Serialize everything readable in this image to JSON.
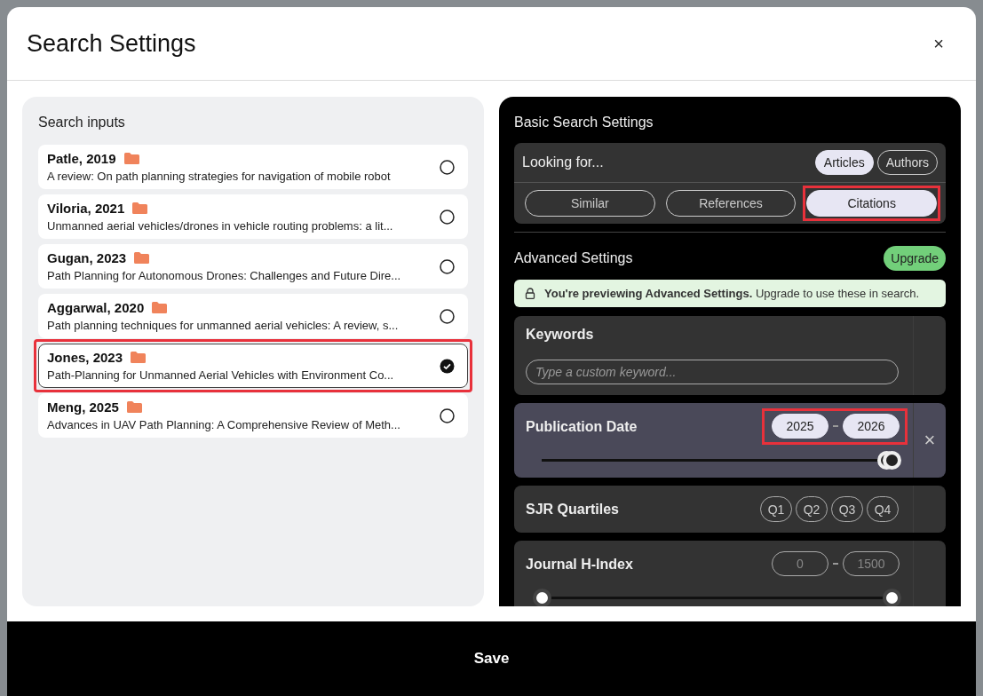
{
  "dialog": {
    "title": "Search Settings",
    "close": "×"
  },
  "search_inputs": {
    "heading": "Search inputs",
    "items": [
      {
        "author": "Patle, 2019",
        "title": "A review: On path planning strategies for navigation of mobile robot",
        "selected": false,
        "highlighted": false
      },
      {
        "author": "Viloria, 2021",
        "title": "Unmanned aerial vehicles/drones in vehicle routing problems: a lit...",
        "selected": false,
        "highlighted": false
      },
      {
        "author": "Gugan, 2023",
        "title": "Path Planning for Autonomous Drones: Challenges and Future Dire...",
        "selected": false,
        "highlighted": false
      },
      {
        "author": "Aggarwal, 2020",
        "title": "Path planning techniques for unmanned aerial vehicles: A review, s...",
        "selected": false,
        "highlighted": false
      },
      {
        "author": "Jones, 2023",
        "title": "Path-Planning for Unmanned Aerial Vehicles with Environment Co...",
        "selected": true,
        "highlighted": true
      },
      {
        "author": "Meng, 2025",
        "title": "Advances in UAV Path Planning: A Comprehensive Review of Meth...",
        "selected": false,
        "highlighted": false
      }
    ]
  },
  "basic": {
    "heading": "Basic Search Settings",
    "looking_for": "Looking for...",
    "targets": [
      {
        "label": "Articles",
        "selected": true
      },
      {
        "label": "Authors",
        "selected": false
      }
    ],
    "modes": [
      {
        "label": "Similar",
        "selected": false,
        "highlighted": false
      },
      {
        "label": "References",
        "selected": false,
        "highlighted": false
      },
      {
        "label": "Citations",
        "selected": true,
        "highlighted": true
      }
    ]
  },
  "advanced": {
    "heading": "Advanced Settings",
    "upgrade": "Upgrade",
    "notice": "**You're previewing Advanced Settings.** Upgrade to use these in search.",
    "filters": [
      {
        "kind": "text",
        "label": "Keywords",
        "placeholder": "Type a custom keyword...",
        "active": false
      },
      {
        "kind": "range",
        "label": "Publication Date",
        "from": {
          "value": "2025"
        },
        "to": {
          "value": "2026"
        },
        "thumbs": [
          {
            "level": 0.985
          },
          {
            "level": 1
          }
        ],
        "active": true,
        "highlighted": true,
        "remove": "×"
      },
      {
        "kind": "chips",
        "label": "SJR Quartiles",
        "chips": [
          {
            "label": "Q1",
            "selected": false
          },
          {
            "label": "Q2",
            "selected": false
          },
          {
            "label": "Q3",
            "selected": false
          },
          {
            "label": "Q4",
            "selected": false
          }
        ],
        "active": false
      },
      {
        "kind": "range",
        "label": "Journal H-Index",
        "from": {
          "placeholder": "0"
        },
        "to": {
          "placeholder": "1500"
        },
        "thumbs": [
          {
            "level": 0
          },
          {
            "level": 1
          }
        ],
        "active": false,
        "highlighted": false
      }
    ]
  },
  "footer": {
    "save": "Save"
  }
}
